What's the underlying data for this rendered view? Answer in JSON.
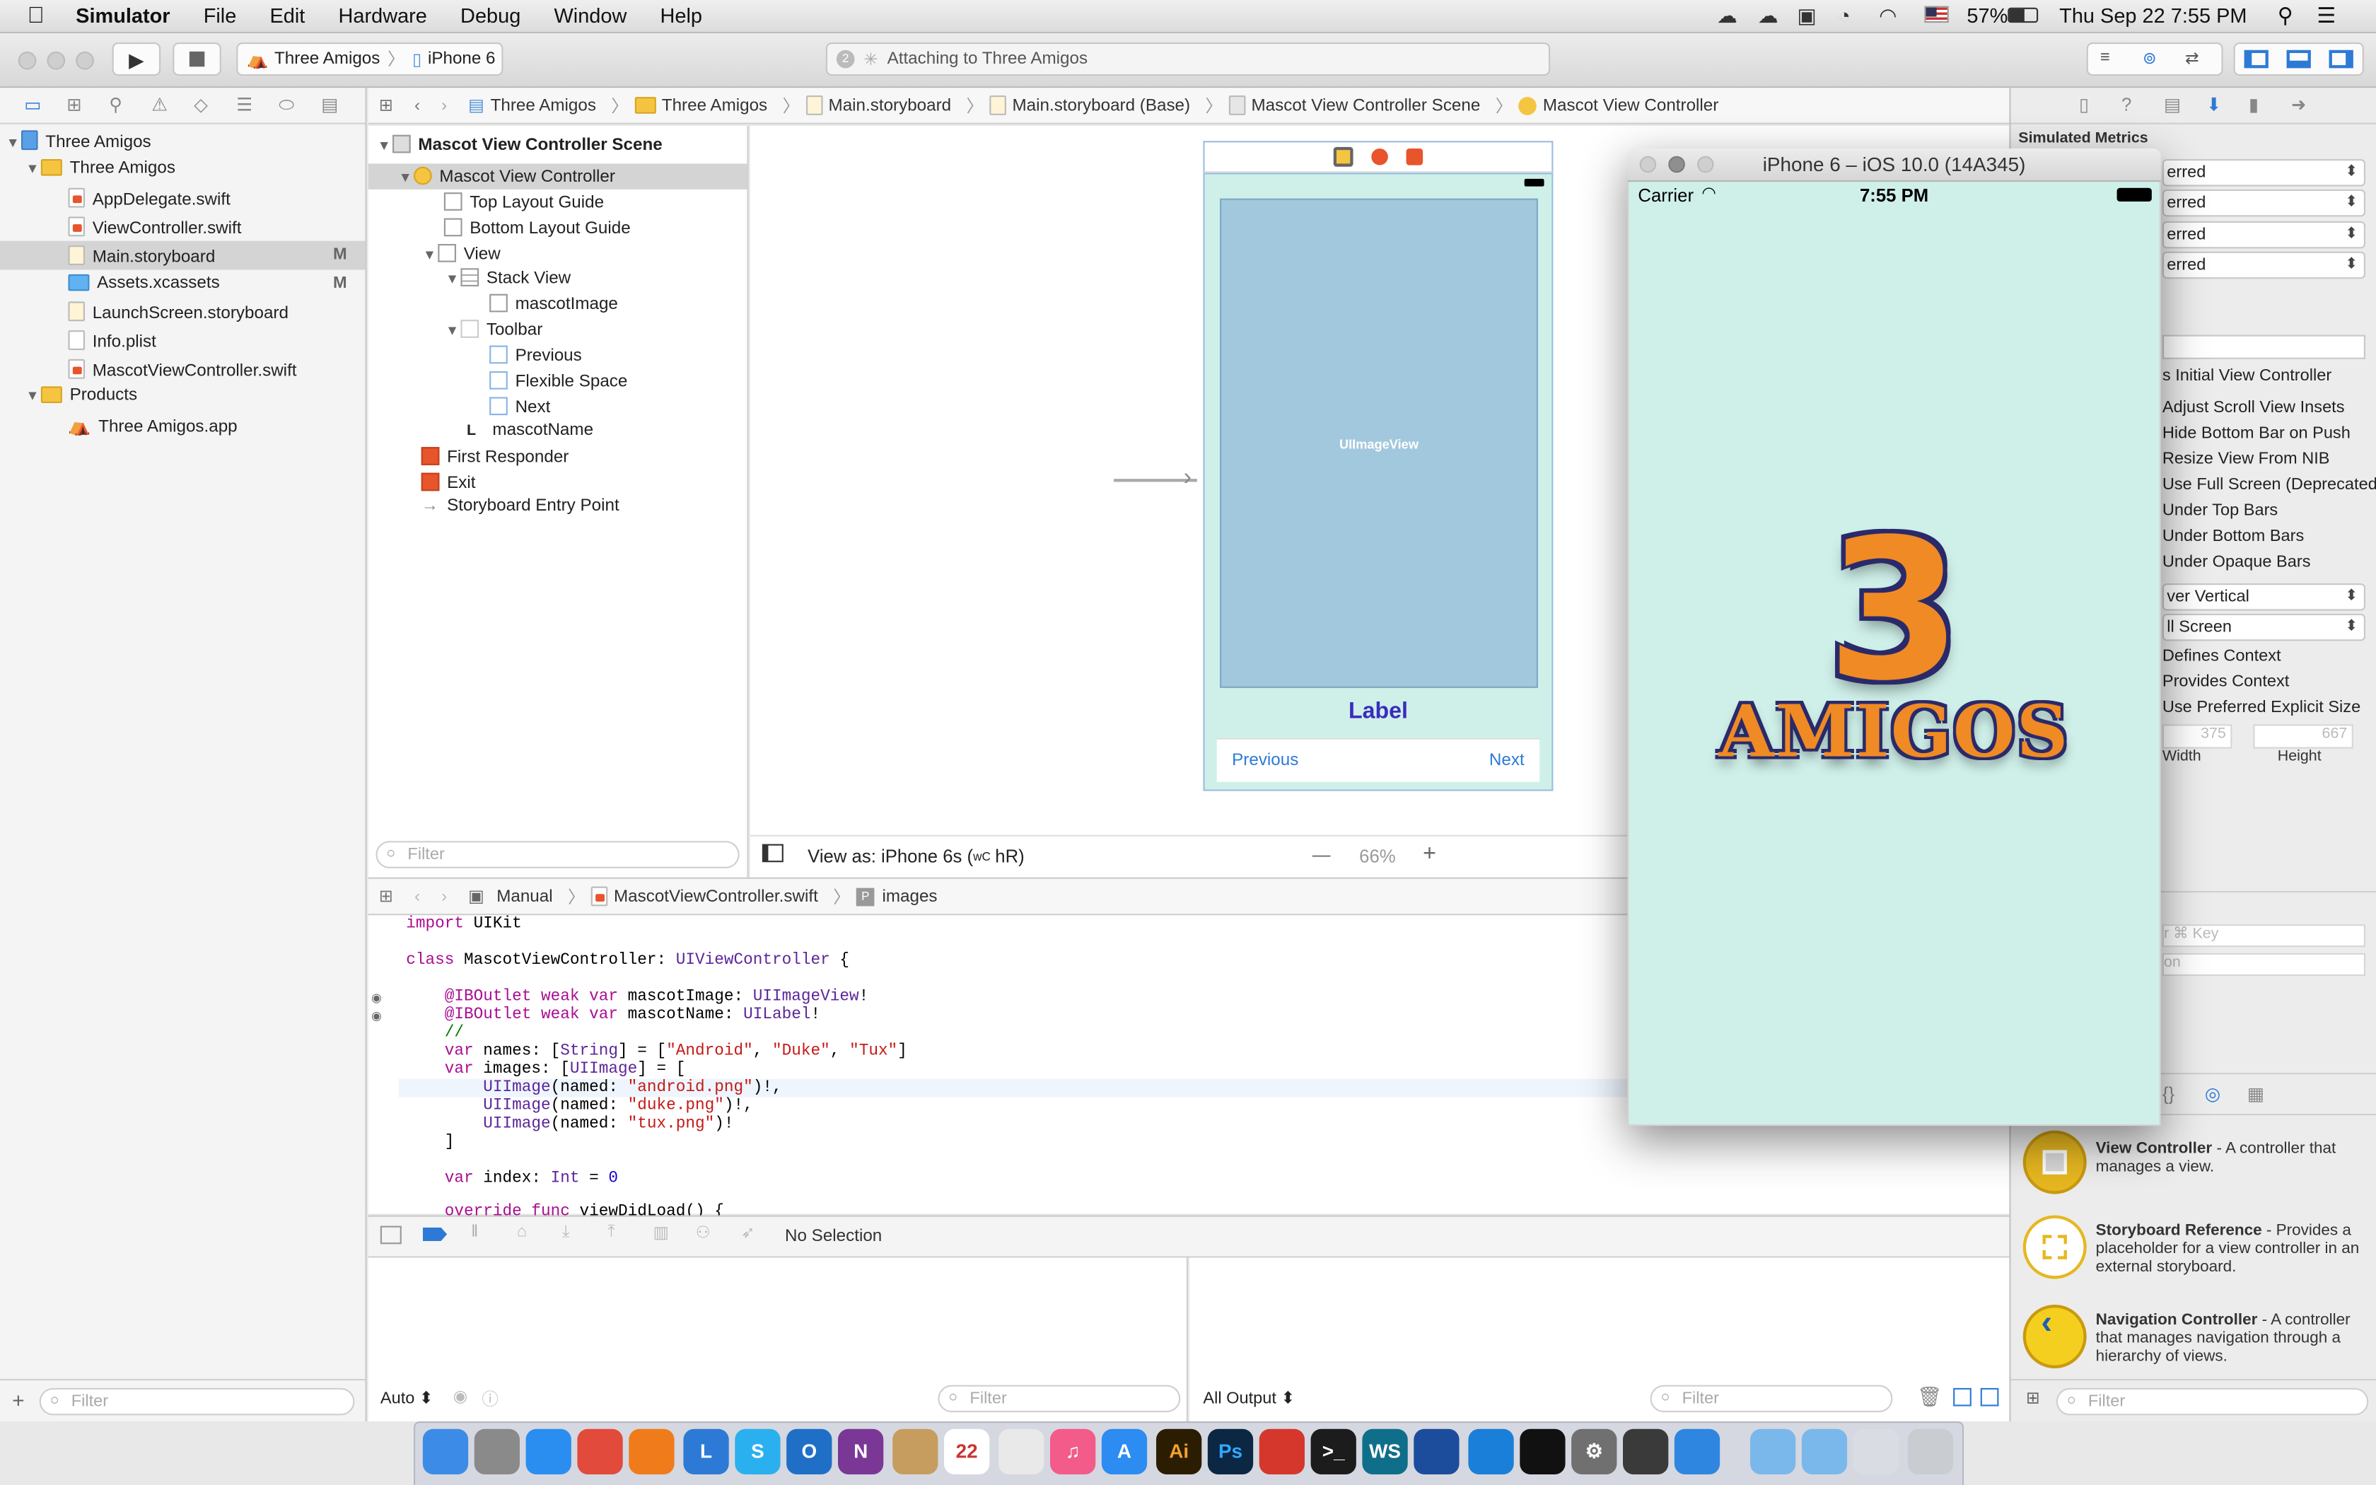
{
  "menubar": {
    "apple": "",
    "app": "Simulator",
    "items": [
      "File",
      "Edit",
      "Hardware",
      "Debug",
      "Window",
      "Help"
    ],
    "battery": "57%",
    "clock": "Thu Sep 22  7:55 PM"
  },
  "toolbar": {
    "scheme": "Three Amigos",
    "device": "iPhone 6",
    "status": "Attaching to Three Amigos",
    "status_badge": "2"
  },
  "navigator": {
    "items": [
      {
        "label": "Three Amigos",
        "kind": "project"
      },
      {
        "label": "Three Amigos",
        "kind": "folder"
      },
      {
        "label": "AppDelegate.swift",
        "kind": "swift"
      },
      {
        "label": "ViewController.swift",
        "kind": "swift"
      },
      {
        "label": "Main.storyboard",
        "kind": "storyboard",
        "badge": "M"
      },
      {
        "label": "Assets.xcassets",
        "kind": "assets",
        "badge": "M"
      },
      {
        "label": "LaunchScreen.storyboard",
        "kind": "storyboard"
      },
      {
        "label": "Info.plist",
        "kind": "plist"
      },
      {
        "label": "MascotViewController.swift",
        "kind": "swift"
      },
      {
        "label": "Products",
        "kind": "folder"
      },
      {
        "label": "Three Amigos.app",
        "kind": "app"
      }
    ],
    "filter_placeholder": "Filter"
  },
  "jumpbar": [
    "Three Amigos",
    "Three Amigos",
    "Main.storyboard",
    "Main.storyboard (Base)",
    "Mascot View Controller Scene",
    "Mascot View Controller"
  ],
  "outline": {
    "scene": "Mascot View Controller Scene",
    "items": [
      "Mascot View Controller",
      "Top Layout Guide",
      "Bottom Layout Guide",
      "View",
      "Stack View",
      "mascotImage",
      "Toolbar",
      "Previous",
      "Flexible Space",
      "Next",
      "mascotName",
      "First Responder",
      "Exit",
      "Storyboard Entry Point"
    ],
    "filter_placeholder": "Filter"
  },
  "canvas": {
    "image_placeholder": "UIImageView",
    "label": "Label",
    "previous": "Previous",
    "next": "Next",
    "view_as": "View as: iPhone 6s (",
    "size_class_w": "wC",
    "size_class_h": "hR)",
    "zoom_minus": "—",
    "zoom": "66%",
    "zoom_plus": "+"
  },
  "editor": {
    "jump": [
      "Manual",
      "MascotViewController.swift",
      "images"
    ],
    "jump_badge": "P",
    "lines": [
      "import UIKit",
      "",
      "class MascotViewController: UIViewController {",
      "",
      "    @IBOutlet weak var mascotImage: UIImageView!",
      "    @IBOutlet weak var mascotName: UILabel!",
      "    //",
      "    var names: [String] = [\"Android\", \"Duke\", \"Tux\"]",
      "    var images: [UIImage] = [",
      "        UIImage(named: \"android.png\")!,",
      "        UIImage(named: \"duke.png\")!,",
      "        UIImage(named: \"tux.png\")!",
      "    ]",
      "",
      "    var index: Int = 0",
      "",
      "    override func viewDidLoad() {"
    ]
  },
  "debug": {
    "selection": "No Selection",
    "auto": "Auto ⬍",
    "filter": "Filter",
    "output": "All Output ⬍",
    "output_filter": "Filter"
  },
  "simulator": {
    "title": "iPhone 6 – iOS 10.0 (14A345)",
    "carrier": "Carrier",
    "time": "7:55 PM",
    "logo_number": "3",
    "logo_word": "AMIGOS"
  },
  "inspector": {
    "section": "Simulated Metrics",
    "popups": [
      "erred",
      "erred",
      "erred",
      "erred"
    ],
    "checks": [
      "s Initial View Controller",
      "Adjust Scroll View Insets",
      "Hide Bottom Bar on Push",
      "Resize View From NIB",
      "Use Full Screen (Deprecated)",
      "Under Top Bars",
      "Under Bottom Bars",
      "Under Opaque Bars"
    ],
    "transition": "ver Vertical",
    "presentation": "ll Screen",
    "checks2": [
      "Defines Context",
      "Provides Context",
      "Use Preferred Explicit Size"
    ],
    "width_val": "375",
    "height_val": "667",
    "width_label": "Width",
    "height_label": "Height",
    "key_placeholder": "r ⌘ Key",
    "tion": "on",
    "library": [
      {
        "title": "View Controller",
        "desc": " - A controller that manages a view."
      },
      {
        "title": "Storyboard Reference",
        "desc": " - Provides a placeholder for a view controller in an external storyboard."
      },
      {
        "title": "Navigation Controller",
        "desc": " - A controller that manages navigation through a hierarchy of views."
      }
    ],
    "filter_placeholder": "Filter"
  },
  "dock": [
    {
      "name": "finder",
      "color": "#3c8ce7",
      "glyph": ""
    },
    {
      "name": "launchpad",
      "color": "#8a8a8a",
      "glyph": ""
    },
    {
      "name": "safari",
      "color": "#2a8ef0",
      "glyph": ""
    },
    {
      "name": "chrome",
      "color": "#e24a3b",
      "glyph": ""
    },
    {
      "name": "firefox",
      "color": "#f07b1b",
      "glyph": ""
    },
    {
      "name": "lync",
      "color": "#2d7ad6",
      "glyph": "L"
    },
    {
      "name": "skype",
      "color": "#2ab0ee",
      "glyph": "S"
    },
    {
      "name": "outlook",
      "color": "#1f6fc6",
      "glyph": "O"
    },
    {
      "name": "onenote",
      "color": "#7a3796",
      "glyph": "N"
    },
    {
      "name": "notes-folder",
      "color": "#c69d5f",
      "glyph": ""
    },
    {
      "name": "calendar",
      "color": "#ffffff",
      "glyph": "22"
    },
    {
      "name": "photos",
      "color": "#e9e9e9",
      "glyph": ""
    },
    {
      "name": "itunes",
      "color": "#f25b8a",
      "glyph": "♫"
    },
    {
      "name": "app-store",
      "color": "#2c8cf1",
      "glyph": "A"
    },
    {
      "name": "illustrator",
      "color": "#2b1d02",
      "glyph": "Ai"
    },
    {
      "name": "photoshop",
      "color": "#0b2744",
      "glyph": "Ps"
    },
    {
      "name": "remote-desktop",
      "color": "#d5372d",
      "glyph": ""
    },
    {
      "name": "terminal",
      "color": "#1c1c1c",
      "glyph": ">_"
    },
    {
      "name": "webstorm",
      "color": "#0f6e8a",
      "glyph": "WS"
    },
    {
      "name": "sourcetree",
      "color": "#1c4d9c",
      "glyph": ""
    },
    {
      "name": "xcode",
      "color": "#1a7fd8",
      "glyph": ""
    },
    {
      "name": "activity-monitor",
      "color": "#111111",
      "glyph": ""
    },
    {
      "name": "system-preferences",
      "color": "#707070",
      "glyph": "⚙"
    },
    {
      "name": "github",
      "color": "#3a3a3a",
      "glyph": ""
    },
    {
      "name": "simulator",
      "color": "#2e86e0",
      "glyph": ""
    },
    {
      "name": "applications-folder",
      "color": "#7ab8ec",
      "glyph": ""
    },
    {
      "name": "downloads-folder",
      "color": "#7ab8ec",
      "glyph": ""
    },
    {
      "name": "documents-stack",
      "color": "#d9dde3",
      "glyph": ""
    },
    {
      "name": "trash",
      "color": "#c9ccd1",
      "glyph": ""
    }
  ]
}
